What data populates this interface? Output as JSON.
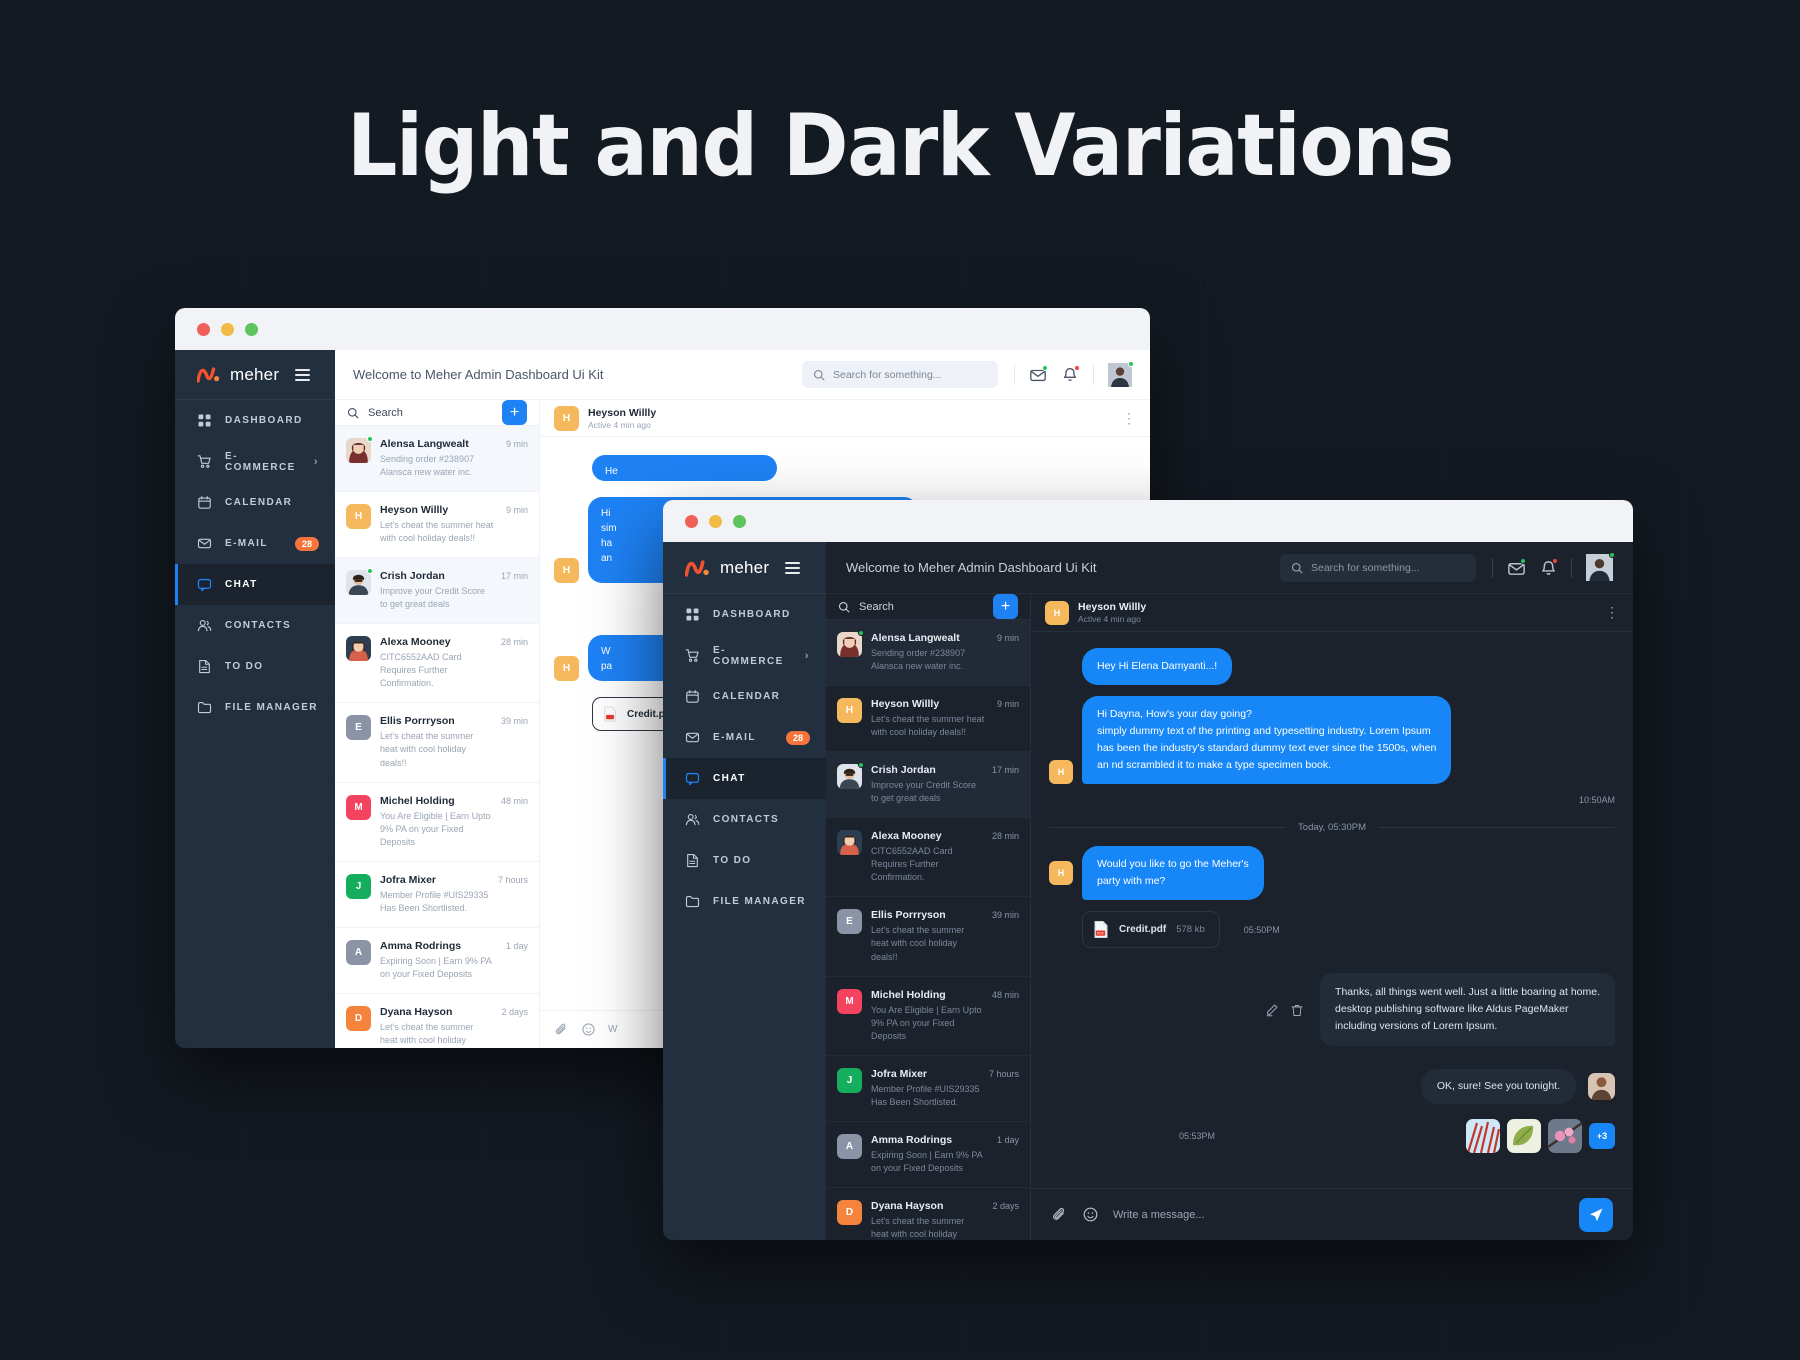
{
  "headline": "Light and Dark Variations",
  "brand": {
    "name": "meher",
    "logo_icon": "meher-logo-icon",
    "menu_icon": "hamburger-icon"
  },
  "accent_colors": {
    "primary_blue": "#1787f7",
    "brand_orange": "#f4743b",
    "sidebar_dark": "#222f3e",
    "panel_dark": "#1b222c",
    "online_green": "#22c55e",
    "notif_red": "#ef4444"
  },
  "sidebar": {
    "items": [
      {
        "label": "DASHBOARD",
        "icon": "grid-icon",
        "active": false
      },
      {
        "label": "E-COMMERCE",
        "icon": "cart-icon",
        "active": false,
        "chevron": "›"
      },
      {
        "label": "CALENDAR",
        "icon": "calendar-icon",
        "active": false
      },
      {
        "label": "E-MAIL",
        "icon": "mail-icon",
        "active": false,
        "badge": "28"
      },
      {
        "label": "CHAT",
        "icon": "chat-icon",
        "active": true
      },
      {
        "label": "CONTACTS",
        "icon": "contacts-icon",
        "active": false
      },
      {
        "label": "TO DO",
        "icon": "todo-icon",
        "active": false
      },
      {
        "label": "FILE MANAGER",
        "icon": "folder-icon",
        "active": false
      }
    ]
  },
  "topbar": {
    "welcome": "Welcome to Meher Admin Dashboard Ui Kit",
    "search_placeholder": "Search for something...",
    "search_icon": "search-icon",
    "mail_icon": "envelope-icon",
    "bell_icon": "bell-icon",
    "avatar": "user-avatar"
  },
  "chat_list": {
    "search_label": "Search",
    "search_icon": "search-icon",
    "add_label": "+",
    "rows": [
      {
        "name": "Alensa Langwealt",
        "preview": "Sending order #238907 Alansca new water inc.",
        "time": "9 min",
        "avatar_type": "photo",
        "photo": "woman-1",
        "online": true,
        "selected": true
      },
      {
        "name": "Heyson Willly",
        "preview": "Let's cheat the summer heat with cool holiday deals!!",
        "time": "9 min",
        "avatar_type": "initial",
        "initial": "H",
        "color": "#f5b85c",
        "online": false,
        "selected": false
      },
      {
        "name": "Crish Jordan",
        "preview": "Improve your Credit Score to get great deals",
        "time": "17 min",
        "avatar_type": "photo",
        "photo": "man-1",
        "online": true,
        "selected": true
      },
      {
        "name": "Alexa Mooney",
        "preview": "CITC6552AAD Card Requires Further Confirmation.",
        "time": "28 min",
        "avatar_type": "photo",
        "photo": "woman-2",
        "online": false,
        "selected": false
      },
      {
        "name": "Ellis Porrryson",
        "preview": "Let's cheat the summer heat with cool holiday deals!!",
        "time": "39 min",
        "avatar_type": "initial",
        "initial": "E",
        "color": "#8a94a6",
        "online": false,
        "selected": false
      },
      {
        "name": "Michel Holding",
        "preview": "You Are Eligible | Earn Upto 9% PA on your Fixed Deposits",
        "time": "48 min",
        "avatar_type": "initial",
        "initial": "M",
        "color": "#f4435f",
        "online": false,
        "selected": false
      },
      {
        "name": "Jofra Mixer",
        "preview": "Member Profile #UIS29335 Has Been Shortlisted.",
        "time": "7 hours",
        "avatar_type": "initial",
        "initial": "J",
        "color": "#15ad5e",
        "online": false,
        "selected": false
      },
      {
        "name": "Amma Rodrings",
        "preview": "Expiring Soon | Earn 9% PA on your Fixed Deposits",
        "time": "1 day",
        "avatar_type": "initial",
        "initial": "A",
        "color": "#8a94a6",
        "online": false,
        "selected": false
      },
      {
        "name": "Dyana Hayson",
        "preview": "Let's cheat the summer heat with cool holiday deals!!",
        "time": "2 days",
        "avatar_type": "initial",
        "initial": "D",
        "color": "#f4843b",
        "online": false,
        "selected": false
      }
    ]
  },
  "thread": {
    "header": {
      "name": "Heyson Willly",
      "status": "Active 4 min ago",
      "initial": "H",
      "menu_icon": "kebab-menu-icon"
    },
    "messages": [
      {
        "id": "m1",
        "side": "in",
        "text": "Hey Hi Elena Damyanti...!",
        "avatar": ""
      },
      {
        "id": "m2",
        "side": "in",
        "avatar": "H",
        "lines": [
          "Hi Dayna, How's your day going?",
          "simply dummy text of the printing and typesetting industry. Lorem Ipsum",
          "has been the industry's standard dummy text ever since the 1500s, when",
          "an nd scrambled it to make a type specimen book."
        ],
        "time": "10:50AM"
      },
      {
        "id": "sep",
        "type": "separator",
        "label": "Today, 05:30PM"
      },
      {
        "id": "m3",
        "side": "in",
        "avatar": "H",
        "lines": [
          "Would you like to go the Meher's",
          "party with me?"
        ],
        "time": "05:50PM",
        "attachment": {
          "name": "Credit.pdf",
          "size": "578 kb",
          "icon": "pdf-file-icon"
        }
      },
      {
        "id": "m4",
        "side": "out",
        "lines": [
          "Thanks, all things went well. Just a little boaring at home.",
          "desktop publishing software like Aldus PageMaker",
          "including versions of Lorem Ipsum."
        ],
        "actions": {
          "edit_icon": "edit-pencil-icon",
          "delete_icon": "trash-icon"
        }
      },
      {
        "id": "m5",
        "side": "out",
        "text": "OK, sure! See you tonight.",
        "time": "05:53PM",
        "avatar": "woman-3",
        "thumbnails": [
          {
            "name": "red-grass-photo",
            "c1": "#cfe8f7",
            "c2": "#c0392b"
          },
          {
            "name": "green-leaf-photo",
            "c1": "#e8eddb",
            "c2": "#8fae4a"
          },
          {
            "name": "pink-blossom-photo",
            "c1": "#6d7a8c",
            "c2": "#e38fb4"
          }
        ],
        "more_label": "+3"
      }
    ],
    "composer": {
      "attach_icon": "paperclip-icon",
      "emoji_icon": "smiley-icon",
      "placeholder": "Write a message...",
      "send_icon": "send-plane-icon"
    }
  },
  "light_thread": {
    "messages": [
      {
        "text": "He"
      },
      {
        "lines": [
          "Hi",
          "sim",
          "ha",
          "an"
        ]
      },
      {
        "lines": [
          "W",
          "pa"
        ]
      }
    ],
    "composer_placeholder": "W"
  }
}
